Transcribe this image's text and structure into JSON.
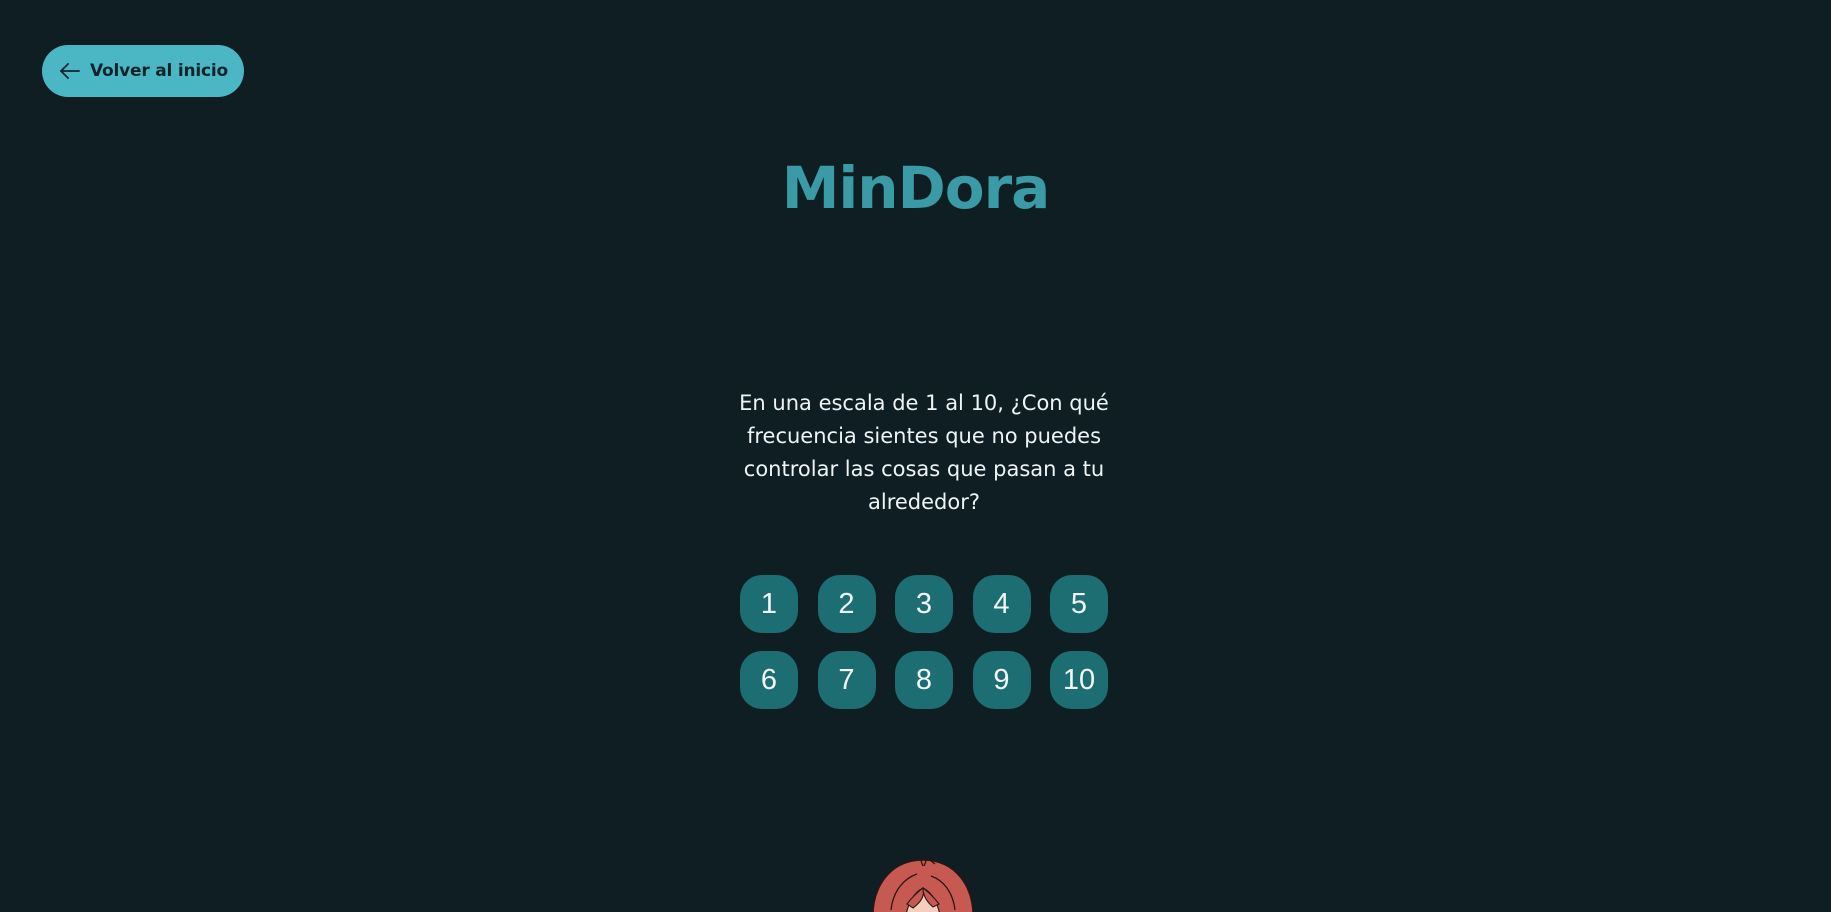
{
  "nav": {
    "back_label": "Volver al inicio"
  },
  "app": {
    "title": "MinDora"
  },
  "question": {
    "text": "En una escala de 1 al 10, ¿Con qué frecuencia sientes que no puedes controlar las cosas que pasan a tu alrededor?"
  },
  "scale": {
    "options": [
      "1",
      "2",
      "3",
      "4",
      "5",
      "6",
      "7",
      "8",
      "9",
      "10"
    ]
  },
  "icons": {
    "back": "arrow-left-icon",
    "mascot": "girl-mascot-illustration"
  },
  "colors": {
    "background": "#0f1e22",
    "accent": "#4cb7c4",
    "title": "#3a9aa6",
    "option_button": "#1d6e73",
    "mascot_hair": "#c65a52"
  }
}
